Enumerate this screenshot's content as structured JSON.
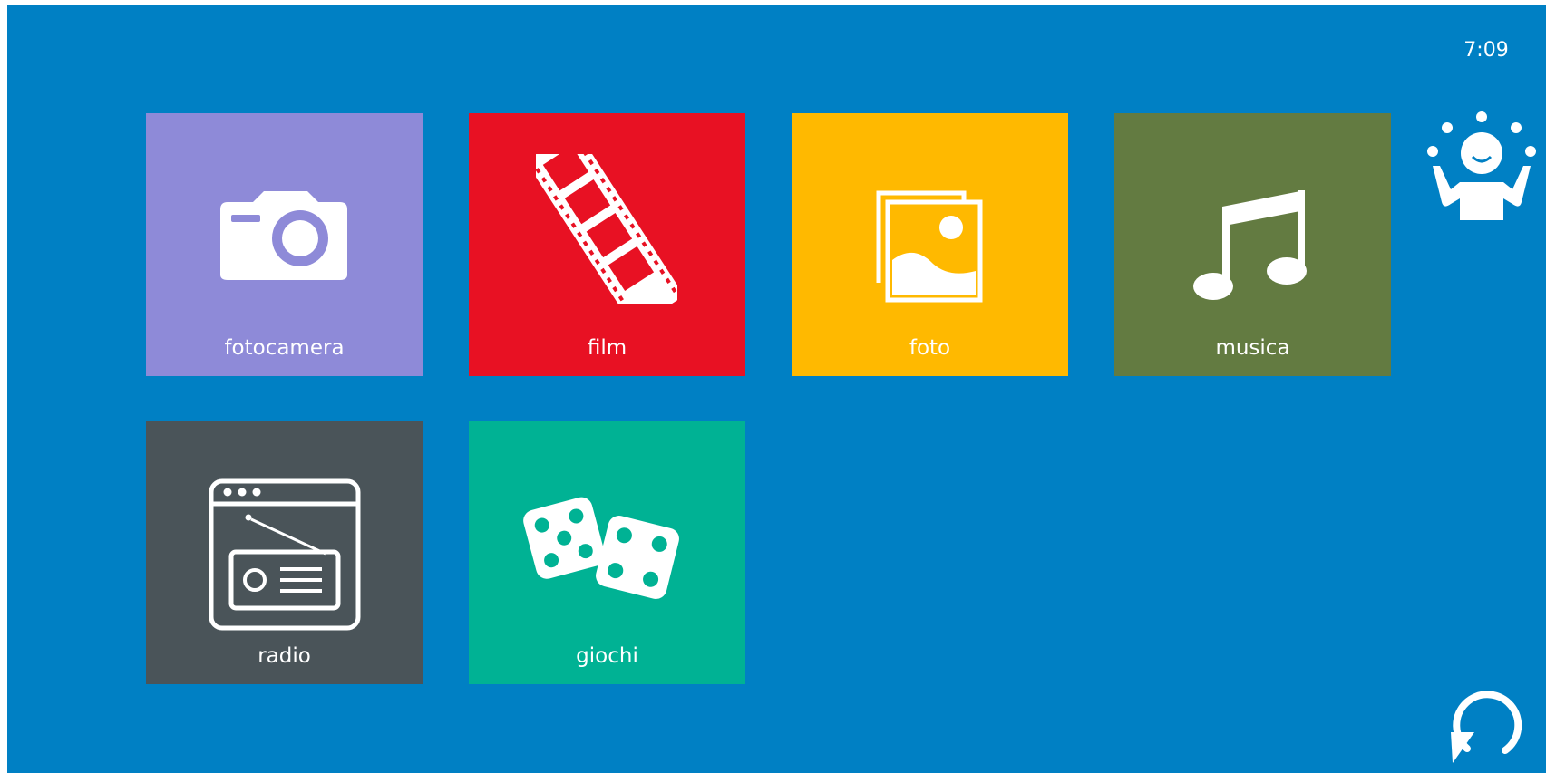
{
  "status_bar": {
    "time": "7:09"
  },
  "tiles": [
    {
      "id": "fotocamera",
      "label": "fotocamera",
      "color": "#8e8ad8",
      "icon": "camera-icon"
    },
    {
      "id": "film",
      "label": "film",
      "color": "#e81123",
      "icon": "film-strip-icon"
    },
    {
      "id": "foto",
      "label": "foto",
      "color": "#ffb900",
      "icon": "photos-icon"
    },
    {
      "id": "musica",
      "label": "musica",
      "color": "#637b41",
      "icon": "music-note-icon"
    },
    {
      "id": "radio",
      "label": "radio",
      "color": "#4a5459",
      "icon": "radio-icon"
    },
    {
      "id": "giochi",
      "label": "giochi",
      "color": "#00b294",
      "icon": "dice-icon"
    }
  ],
  "side_icons": {
    "user": "juggler-user-icon",
    "refresh": "refresh-icon"
  },
  "colors": {
    "background": "#0080c4",
    "foreground": "#ffffff"
  }
}
